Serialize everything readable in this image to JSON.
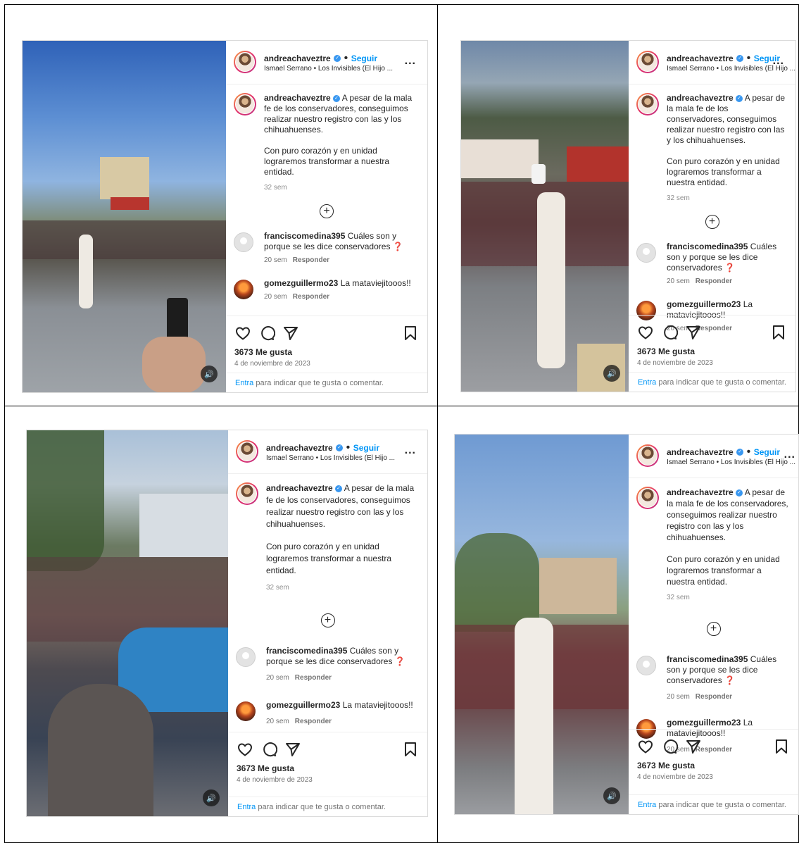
{
  "post": {
    "username": "andreachaveztre",
    "follow_label": "Seguir",
    "separator": "•",
    "audio": "Ismael Serrano • Los Invisibles (El Hijo ...",
    "more_label": "...",
    "caption_p1": "A pesar de la mala fe de los conservadores, conseguimos realizar nuestro registro con las y los chihuahuenses.",
    "caption_p2": "Con puro corazón y en unidad lograremos transformar a nuestra entidad.",
    "caption_time": "32 sem",
    "add_comment_glyph": "+",
    "comments": [
      {
        "user": "franciscomedina395",
        "text": "Cuáles son y porque se les dice conservadores",
        "emoji": "❓",
        "time": "20 sem",
        "reply": "Responder"
      },
      {
        "user": "gomezguillermo23",
        "text": "La mataviejitooos!!",
        "emoji": "",
        "time": "20 sem",
        "reply": "Responder"
      }
    ],
    "likes": "3673 Me gusta",
    "date": "4 de noviembre de 2023",
    "login_link": "Entra",
    "login_text": " para indicar que te gusta o comentar.",
    "sound_glyph": "🔊"
  },
  "colors": {
    "link": "#0095f6",
    "border": "#dbdbdb",
    "verified": "#3897f0"
  }
}
